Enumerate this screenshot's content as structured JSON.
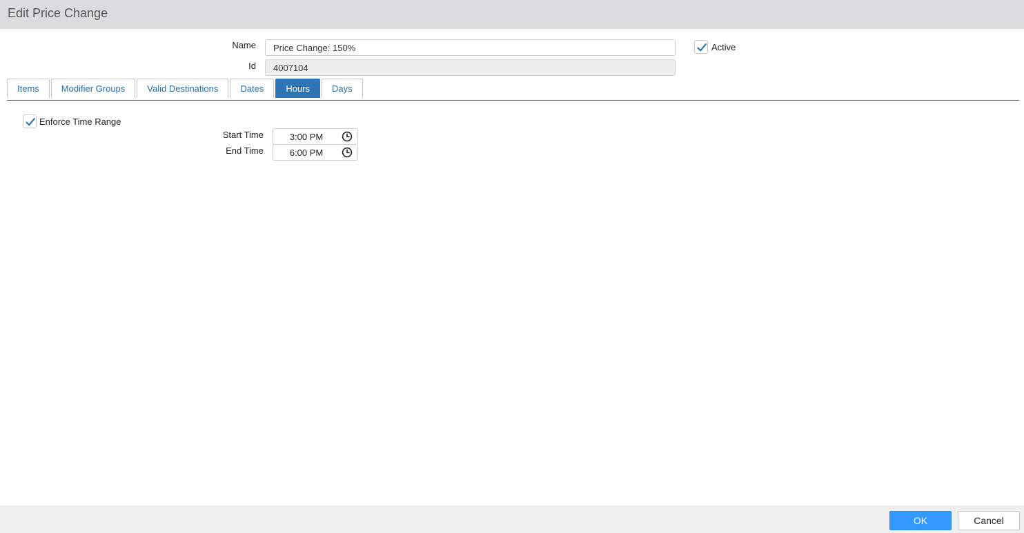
{
  "window": {
    "title": "Edit Price Change"
  },
  "form": {
    "name_label": "Name",
    "name_value": "Price Change: 150%",
    "id_label": "Id",
    "id_value": "4007104",
    "active_label": "Active",
    "active_checked": true
  },
  "tabs": [
    {
      "label": "Items",
      "active": false
    },
    {
      "label": "Modifier Groups",
      "active": false
    },
    {
      "label": "Valid Destinations",
      "active": false
    },
    {
      "label": "Dates",
      "active": false
    },
    {
      "label": "Hours",
      "active": true
    },
    {
      "label": "Days",
      "active": false
    }
  ],
  "hours": {
    "enforce_label": "Enforce Time Range",
    "enforce_checked": true,
    "start_label": "Start Time",
    "start_value": "3:00 PM",
    "end_label": "End Time",
    "end_value": "6:00 PM",
    "picker_icon": "clock-icon"
  },
  "footer": {
    "ok_label": "OK",
    "cancel_label": "Cancel"
  },
  "colors": {
    "accent": "#2e75b6",
    "ok_button": "#3399ff",
    "check_mark": "#2e75b6"
  }
}
